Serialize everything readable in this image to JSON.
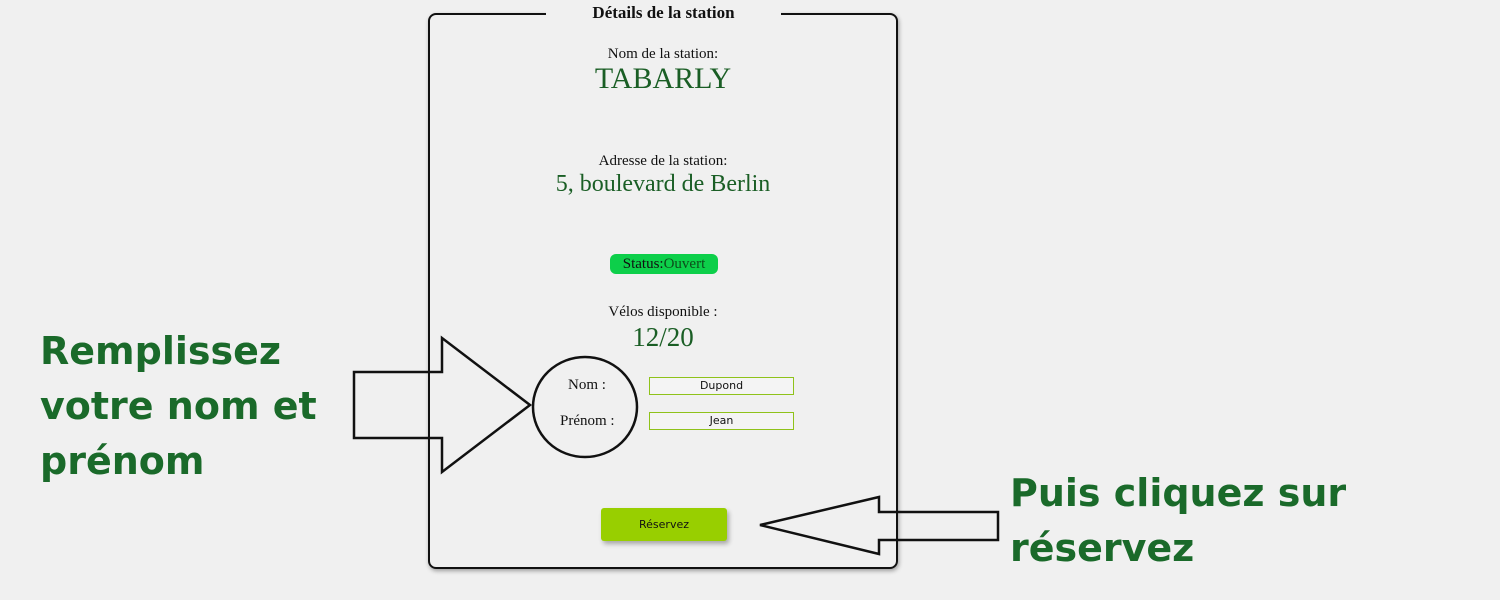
{
  "panel": {
    "title": "Détails de la station",
    "station_name_label": "Nom de la station:",
    "station_name": "TABARLY",
    "address_label": "Adresse de la station:",
    "address": "5, boulevard de Berlin",
    "status_label": "Status:",
    "status_value": "Ouvert",
    "bikes_label": "Vélos disponible :",
    "bikes_value": "12/20",
    "nom_label": "Nom :",
    "nom_value": "Dupond",
    "prenom_label": "Prénom :",
    "prenom_value": "Jean",
    "reserve_button": "Réservez"
  },
  "annotations": {
    "left_line1": "Remplissez",
    "left_line2": "votre nom et",
    "left_line3": "prénom",
    "right_line1": "Puis cliquez sur",
    "right_line2": "réservez"
  },
  "colors": {
    "accent_green": "#1a5e25",
    "status_badge": "#0dcf4a",
    "button": "#98cf00"
  }
}
